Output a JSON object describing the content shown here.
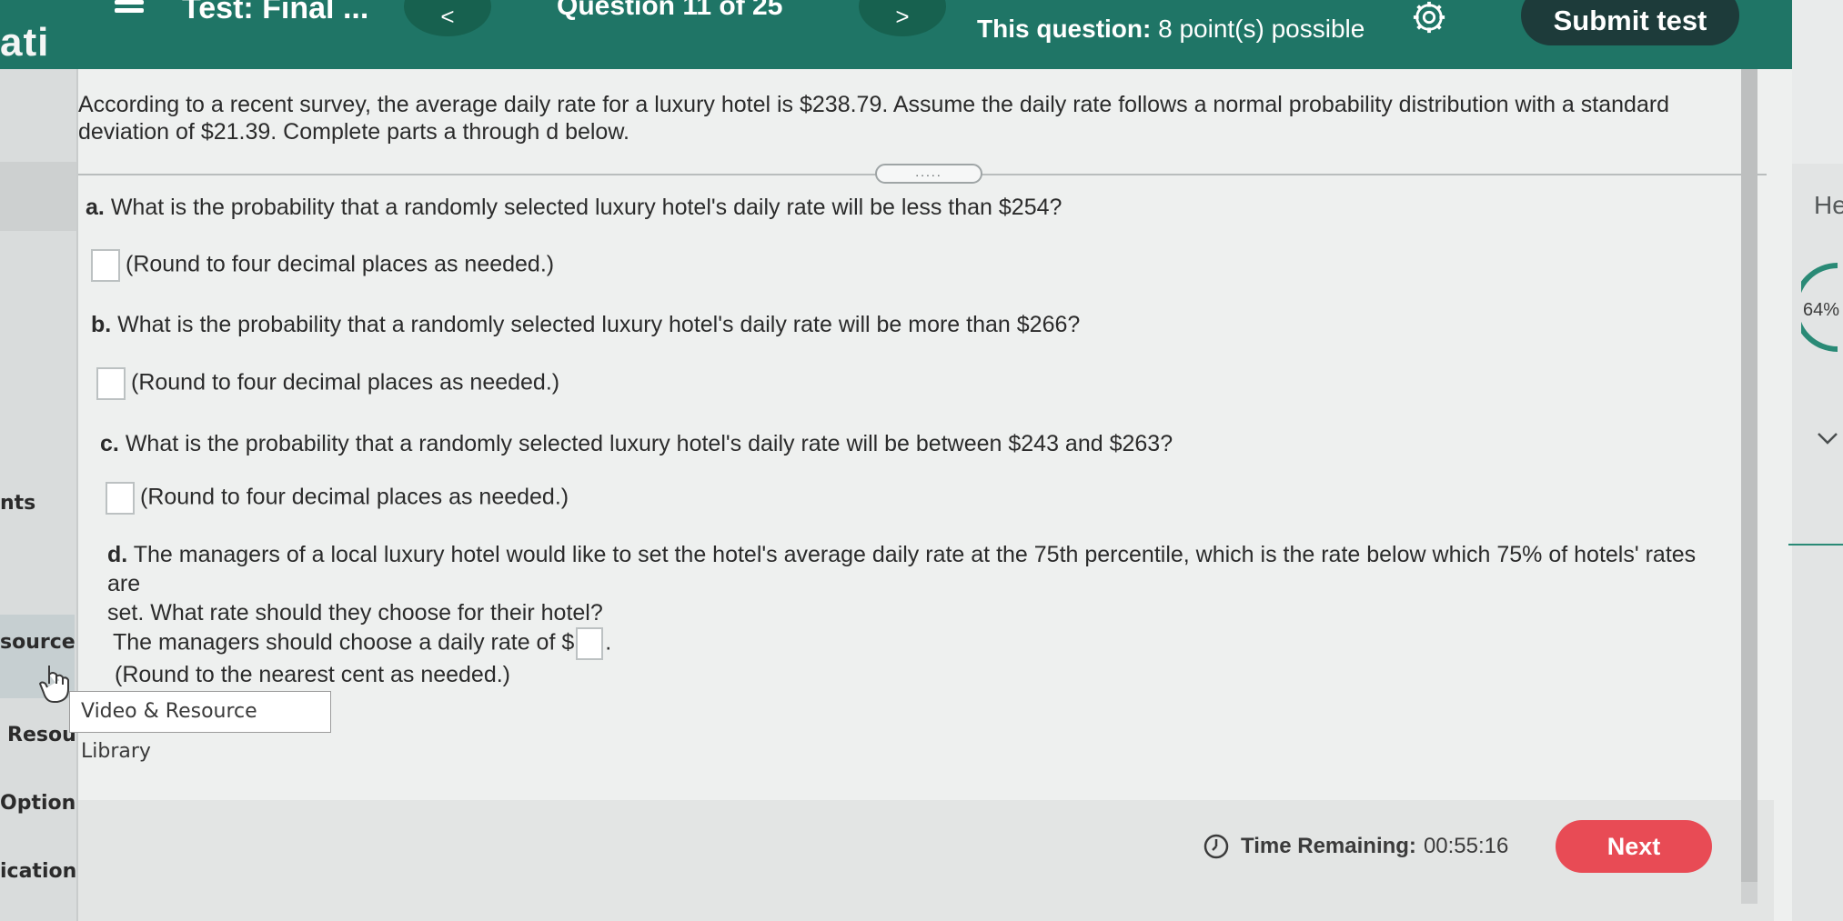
{
  "header": {
    "left_partial": "ati",
    "test_title": "Test: Final ...",
    "question_counter": "Question 11 of 25",
    "points_lead": "This question:",
    "points_value": "8 point(s) possible",
    "submit_label": "Submit test",
    "prev_symbol": "<",
    "next_symbol": ">"
  },
  "sidebar": {
    "items": [
      {
        "label": "nts"
      },
      {
        "label": "source"
      },
      {
        "label": "Resourc"
      },
      {
        "label": "Options"
      },
      {
        "label": "ication To"
      }
    ]
  },
  "question": {
    "intro": "According to a recent survey, the average daily rate for a luxury hotel is $238.79. Assume the daily rate follows a normal probability distribution with a standard deviation of $21.39. Complete parts a through d below.",
    "expander_symbol": ".....",
    "parts": [
      {
        "letter": "a.",
        "text": "What is the probability that a randomly selected luxury hotel's daily rate will be less than $254?",
        "hint": "(Round to four decimal places as needed.)"
      },
      {
        "letter": "b.",
        "text": "What is the probability that a randomly selected luxury hotel's daily rate will be more than $266?",
        "hint": "(Round to four decimal places as needed.)"
      },
      {
        "letter": "c.",
        "text": "What is the probability that a randomly selected luxury hotel's daily rate will be between $243 and $263?",
        "hint": "(Round to four decimal places as needed.)"
      },
      {
        "letter": "d.",
        "text_line1": "The managers of a local luxury hotel would like to set the hotel's average daily rate at the 75th percentile, which is the rate below which 75% of hotels' rates are",
        "text_line2": "set. What rate should they choose for their hotel?",
        "answer_prefix": "The managers should choose a daily rate of $",
        "answer_suffix": ".",
        "hint": "(Round to the nearest cent as needed.)"
      }
    ]
  },
  "tooltip": "Video & Resource Library",
  "footer": {
    "timer_lead": "Time Remaining:",
    "timer_value": "00:55:16",
    "next_label": "Next"
  },
  "right_panel": {
    "label": "He",
    "percent": "64%"
  },
  "colors": {
    "header": "#1f7566",
    "submit": "#1d3b3a",
    "next": "#e84b55"
  }
}
